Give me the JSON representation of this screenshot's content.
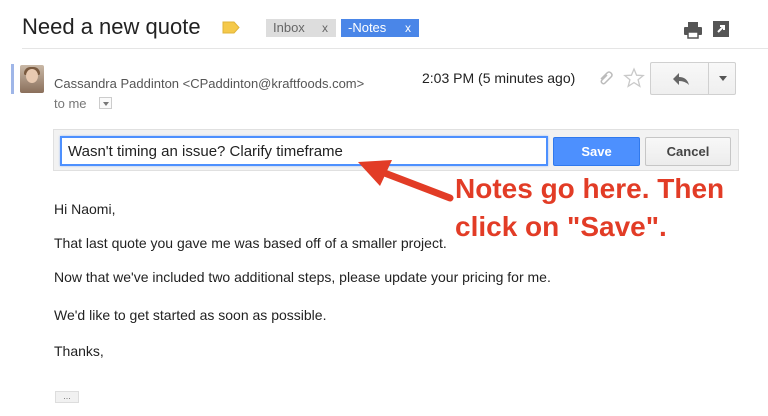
{
  "email": {
    "subject": "Need a new quote",
    "labels": [
      {
        "name": "Inbox",
        "remove": "x"
      },
      {
        "name": "-Notes",
        "remove": "x"
      }
    ],
    "sender": "Cassandra Paddinton <CPaddinton@kraftfoods.com>",
    "to": "to me",
    "timestamp": "2:03 PM (5 minutes ago)"
  },
  "notes": {
    "value": "Wasn't timing an issue? Clarify timeframe",
    "save_label": "Save",
    "cancel_label": "Cancel"
  },
  "body": {
    "greeting": "Hi Naomi,",
    "line1": "That last quote you gave me was based off of a smaller project.",
    "line2": "Now that we've included two additional steps, please update your pricing for me.",
    "line3": "We'd like to get started as soon as possible.",
    "closing": "Thanks,",
    "trimmed": "..."
  },
  "annotation": {
    "line1": "Notes go here. Then",
    "line2": "click on \"Save\".",
    "color": "#e23c26"
  },
  "colors": {
    "accent": "#4d90fe",
    "notes_label": "#4a86e8",
    "inbox_label": "#dddddd"
  },
  "icons": [
    "label-tag-icon",
    "print-icon",
    "popout-icon",
    "attachment-icon",
    "star-icon",
    "reply-icon",
    "chevron-down-icon"
  ]
}
